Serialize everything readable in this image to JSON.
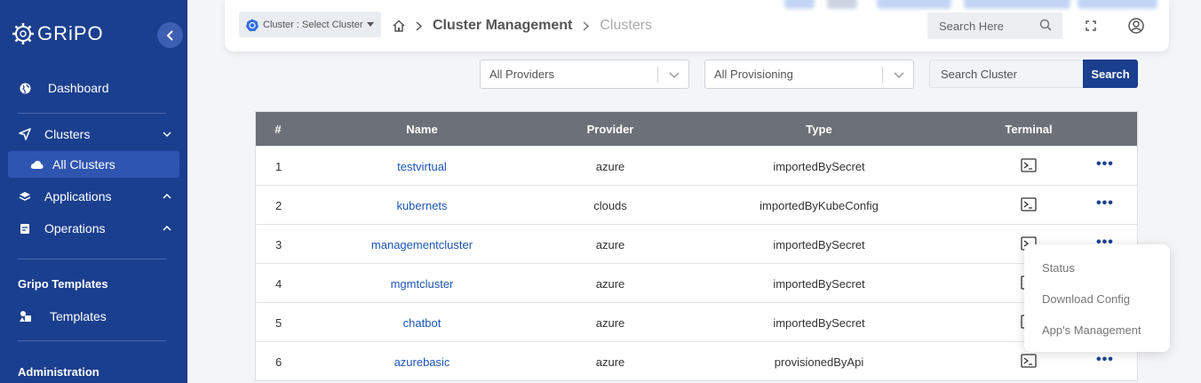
{
  "brand": {
    "name": "GRiPO"
  },
  "sidebar": {
    "dashboard": "Dashboard",
    "clusters": "Clusters",
    "all_clusters": "All Clusters",
    "applications": "Applications",
    "operations": "Operations",
    "templates_section": "Gripo Templates",
    "templates": "Templates",
    "administration": "Administration"
  },
  "header": {
    "cluster_select": "Cluster : Select Cluster",
    "breadcrumb": [
      "Cluster Management",
      "Clusters"
    ],
    "search_placeholder": "Search Here"
  },
  "filters": {
    "providers": "All Providers",
    "provisioning": "All Provisioning",
    "search_placeholder": "Search Cluster",
    "search_button": "Search"
  },
  "table": {
    "columns": [
      "#",
      "Name",
      "Provider",
      "Type",
      "Terminal"
    ],
    "rows": [
      {
        "num": "1",
        "name": "testvirtual",
        "provider": "azure",
        "type": "importedBySecret"
      },
      {
        "num": "2",
        "name": "kubernets",
        "provider": "clouds",
        "type": "importedByKubeConfig"
      },
      {
        "num": "3",
        "name": "managementcluster",
        "provider": "azure",
        "type": "importedBySecret"
      },
      {
        "num": "4",
        "name": "mgmtcluster",
        "provider": "azure",
        "type": "importedBySecret"
      },
      {
        "num": "5",
        "name": "chatbot",
        "provider": "azure",
        "type": "importedBySecret"
      },
      {
        "num": "6",
        "name": "azurebasic",
        "provider": "azure",
        "type": "provisionedByApi"
      }
    ]
  },
  "menu": {
    "items": [
      "Status",
      "Download Config",
      "App's Management"
    ]
  },
  "colors": {
    "sidebar": "#1b3f8f",
    "accent": "#1a3f8f",
    "link": "#1a55b5",
    "table_header": "#6c7177"
  }
}
